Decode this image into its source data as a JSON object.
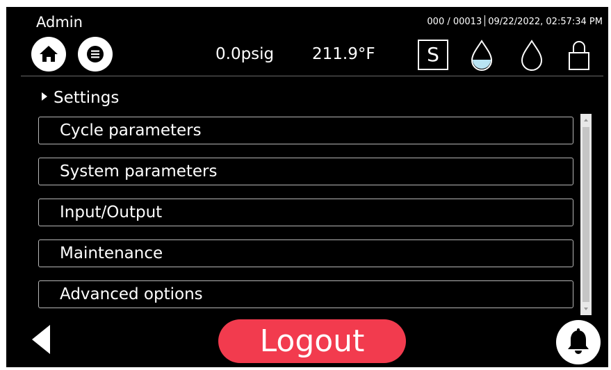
{
  "header": {
    "user_role": "Admin",
    "cycle_counter": "000 / 00013",
    "datetime": "09/22/2022, 02:57:34 PM",
    "pressure": "0.0psig",
    "temperature": "211.9°F",
    "mode_indicator": "S",
    "icons": {
      "home": "home-icon",
      "menu": "menu-icon",
      "water_level": "water-drop-filled-icon",
      "water": "water-drop-outline-icon",
      "lock": "lock-icon"
    }
  },
  "breadcrumb": {
    "label": "Settings"
  },
  "settings_menu": {
    "items": [
      {
        "label": "Cycle parameters"
      },
      {
        "label": "System parameters"
      },
      {
        "label": "Input/Output"
      },
      {
        "label": "Maintenance"
      },
      {
        "label": "Advanced options"
      }
    ]
  },
  "footer": {
    "logout_label": "Logout",
    "back_icon": "back-arrow-icon",
    "bell_icon": "bell-icon"
  },
  "colors": {
    "background": "#000000",
    "foreground": "#ffffff",
    "logout_button": "#f23b4e",
    "water_fill": "#b9e4f3"
  }
}
